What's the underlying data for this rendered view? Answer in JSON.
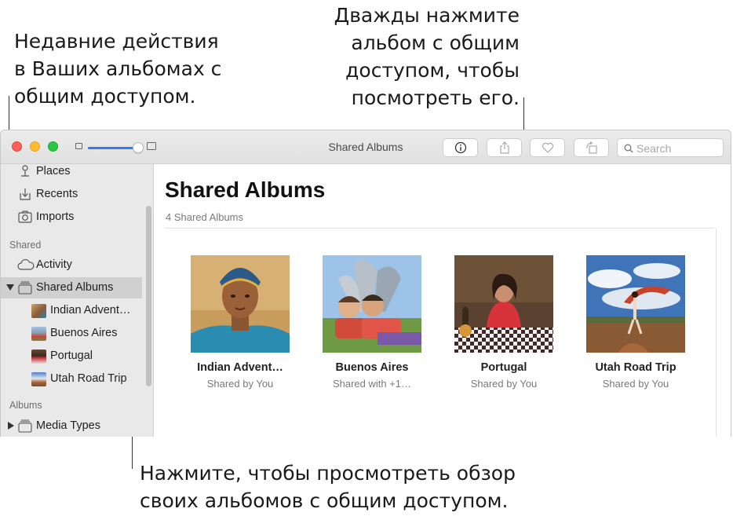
{
  "callouts": {
    "left": [
      "Недавние действия",
      "в Ваших альбомах с",
      "общим доступом."
    ],
    "right": [
      "Дважды нажмите",
      "альбом с общим",
      "доступом, чтобы",
      "посмотреть его."
    ],
    "bottom": [
      "Нажмите, чтобы просмотреть обзор",
      "своих альбомов с общим доступом."
    ]
  },
  "window": {
    "title": "Shared Albums",
    "search_placeholder": "Search"
  },
  "sidebar": {
    "top_items": [
      {
        "label": "Places",
        "icon": "pin-icon"
      },
      {
        "label": "Recents",
        "icon": "download-tray-icon"
      },
      {
        "label": "Imports",
        "icon": "camera-import-icon"
      }
    ],
    "shared_header": "Shared",
    "shared_items": [
      {
        "label": "Activity",
        "icon": "cloud-icon"
      },
      {
        "label": "Shared Albums",
        "icon": "album-stack-icon",
        "selected": true,
        "expanded": true
      }
    ],
    "albums": [
      {
        "label": "Indian Advent…",
        "thumb_color": "#8a5a3a"
      },
      {
        "label": "Buenos Aires",
        "thumb_color": "#6f8fb5"
      },
      {
        "label": "Portugal",
        "thumb_color": "#7a4a34"
      },
      {
        "label": "Utah Road Trip",
        "thumb_color": "#5f86b8"
      }
    ],
    "albums_header": "Albums",
    "albums_items": [
      {
        "label": "Media Types",
        "icon": "album-stack-icon",
        "expanded": false
      }
    ]
  },
  "main": {
    "title": "Shared Albums",
    "count": "4 Shared Albums",
    "albums": [
      {
        "name": "Indian Advent…",
        "subtitle": "Shared by You",
        "scene": "portrait"
      },
      {
        "name": "Buenos Aires",
        "subtitle": "Shared with +1…",
        "scene": "kids"
      },
      {
        "name": "Portugal",
        "subtitle": "Shared by You",
        "scene": "table"
      },
      {
        "name": "Utah Road Trip",
        "subtitle": "Shared by You",
        "scene": "desert"
      }
    ]
  },
  "zoom_slider": {
    "value_fraction": 0.93
  },
  "colors": {
    "accent": "#3478f6",
    "selection": "#d0d0d0",
    "sidebar_bg": "#e9e9e9"
  }
}
